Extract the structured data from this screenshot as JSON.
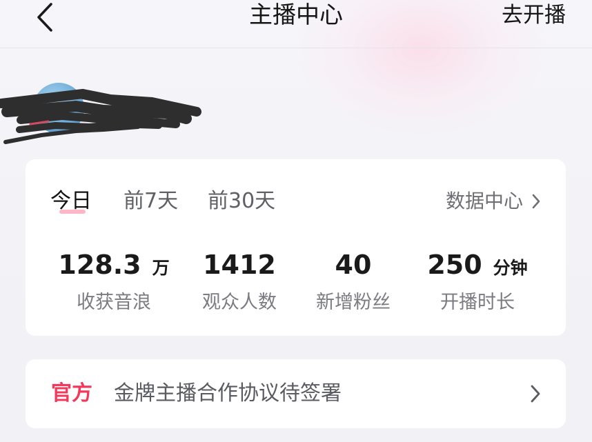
{
  "header": {
    "back_icon": "chevron-left-icon",
    "title": "主播中心",
    "go_live_label": "去开播"
  },
  "profile": {
    "avatar_color": "#6aa9d6",
    "name_redacted": true
  },
  "stats_card": {
    "tabs": [
      {
        "label": "今日",
        "active": true
      },
      {
        "label": "前7天",
        "active": false
      },
      {
        "label": "前30天",
        "active": false
      }
    ],
    "data_center_label": "数据中心",
    "data_center_icon": "chevron-right-icon",
    "stats": [
      {
        "value": "128.3",
        "unit": "万",
        "label": "收获音浪"
      },
      {
        "value": "1412",
        "unit": "",
        "label": "观众人数"
      },
      {
        "value": "40",
        "unit": "",
        "label": "新增粉丝"
      },
      {
        "value": "250",
        "unit": "分钟",
        "label": "开播时长"
      }
    ]
  },
  "notice": {
    "tag": "官方",
    "text": "金牌主播合作协议待签署",
    "icon": "chevron-right-icon"
  },
  "colors": {
    "accent": "#f2395c",
    "tab_underline": "#ffb6c7",
    "card_bg": "#ffffff",
    "page_bg": "#f3f3f7"
  }
}
